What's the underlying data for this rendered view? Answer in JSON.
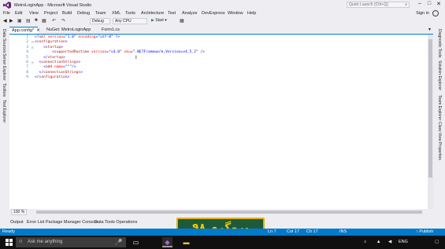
{
  "window": {
    "title": "MetroLoginApp - Microsoft Visual Studio",
    "quick_launch_placeholder": "Quick Launch (Ctrl+Q)"
  },
  "menu": {
    "items": [
      "File",
      "Edit",
      "View",
      "Project",
      "Build",
      "Debug",
      "Team",
      "XML",
      "Tools",
      "Architecture",
      "Test",
      "Analyze",
      "DevExpress",
      "Window",
      "Help"
    ],
    "sign_in": "Sign in"
  },
  "toolbar": {
    "config": "Debug",
    "platform": "Any CPU",
    "start": "Start"
  },
  "left_tabs": [
    "Data Sources",
    "Server Explorer",
    "Toolbox",
    "Test Explorer"
  ],
  "right_tabs": [
    "Diagnostic Tools",
    "Solution Explorer",
    "Team Explorer",
    "Class View",
    "Properties"
  ],
  "tabs": [
    {
      "label": "App.config*",
      "active": true
    },
    {
      "label": "NuGet: MetroLoginApp",
      "active": false
    },
    {
      "label": "Form1.cs",
      "active": false
    }
  ],
  "code_lines": [
    {
      "n": "1",
      "fold": "",
      "parts": [
        [
          "t-b",
          "<?"
        ],
        [
          "t-r",
          "xml"
        ],
        [
          "t-a",
          " version"
        ],
        [
          "t-b",
          "="
        ],
        [
          "t-k",
          "\""
        ],
        [
          "t-b",
          "1.0"
        ],
        [
          "t-k",
          "\""
        ],
        [
          "t-a",
          " encoding"
        ],
        [
          "t-b",
          "="
        ],
        [
          "t-k",
          "\""
        ],
        [
          "t-b",
          "utf-8"
        ],
        [
          "t-k",
          "\""
        ],
        [
          "t-b",
          " ?>"
        ]
      ]
    },
    {
      "n": "2",
      "fold": "⊟",
      "parts": [
        [
          "t-b",
          "<"
        ],
        [
          "t-r",
          "configuration"
        ],
        [
          "t-b",
          ">"
        ]
      ]
    },
    {
      "n": "3",
      "fold": "⊟",
      "parts": [
        [
          "t-k",
          "    "
        ],
        [
          "t-b",
          "<"
        ],
        [
          "t-r",
          "startup"
        ],
        [
          "t-b",
          ">"
        ]
      ]
    },
    {
      "n": "4",
      "fold": "",
      "parts": [
        [
          "t-k",
          "        "
        ],
        [
          "t-b",
          "<"
        ],
        [
          "t-r",
          "supportedRuntime"
        ],
        [
          "t-a",
          " version"
        ],
        [
          "t-b",
          "="
        ],
        [
          "t-k",
          "\""
        ],
        [
          "t-b",
          "v4.0"
        ],
        [
          "t-k",
          "\""
        ],
        [
          "t-a",
          " sku"
        ],
        [
          "t-b",
          "="
        ],
        [
          "t-k",
          "\""
        ],
        [
          "t-b",
          ".NETFramework,Version=v4.5.2"
        ],
        [
          "t-k",
          "\""
        ],
        [
          "t-b",
          " />"
        ]
      ]
    },
    {
      "n": "5",
      "fold": "",
      "parts": [
        [
          "t-k",
          "    "
        ],
        [
          "t-b",
          "</"
        ],
        [
          "t-r",
          "startup"
        ],
        [
          "t-b",
          ">"
        ]
      ]
    },
    {
      "n": "6",
      "fold": "⊟",
      "parts": [
        [
          "t-k",
          "  "
        ],
        [
          "t-b",
          "<"
        ],
        [
          "t-r",
          "connectionStrings"
        ],
        [
          "t-b",
          ">"
        ]
      ]
    },
    {
      "n": "7",
      "fold": "",
      "parts": [
        [
          "t-k",
          "    "
        ],
        [
          "t-b",
          "<"
        ],
        [
          "t-r",
          "add"
        ],
        [
          "t-a",
          " name"
        ],
        [
          "t-b",
          "="
        ],
        [
          "t-k",
          "\""
        ],
        [
          "t-b",
          "\""
        ],
        [
          "t-k",
          "\""
        ],
        [
          "t-b",
          "/>"
        ]
      ]
    },
    {
      "n": "8",
      "fold": "",
      "parts": [
        [
          "t-k",
          "  "
        ],
        [
          "t-b",
          "</"
        ],
        [
          "t-r",
          "connectionStrings"
        ],
        [
          "t-b",
          ">"
        ]
      ]
    },
    {
      "n": "9",
      "fold": "",
      "parts": [
        [
          "t-b",
          "</"
        ],
        [
          "t-r",
          "configuration"
        ],
        [
          "t-b",
          ">"
        ]
      ]
    }
  ],
  "zoom": "100 %",
  "bottom_tabs": [
    "Output",
    "Error List",
    "Package Manager Console",
    "Data Tools Operations"
  ],
  "watermark": "پروگرم ۹۸",
  "status": {
    "ready": "Ready",
    "ln": "Ln 7",
    "col": "Col 17",
    "ch": "Ch 17",
    "ins": "INS",
    "publish": "Publish"
  },
  "taskbar": {
    "search_placeholder": "Ask me anything",
    "lang": "ENG"
  }
}
